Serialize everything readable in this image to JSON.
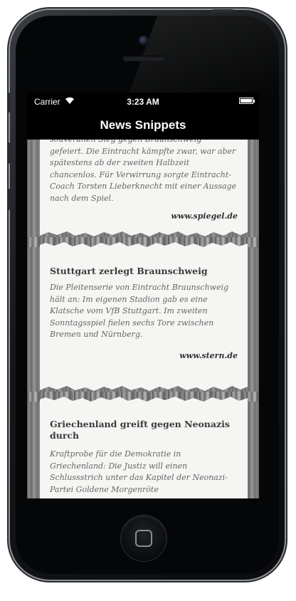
{
  "status_bar": {
    "carrier": "Carrier",
    "time": "3:23 AM"
  },
  "nav": {
    "title": "News Snippets"
  },
  "articles": [
    {
      "title": "",
      "body_line_0": "souveränen Sieg gegen Braunschweig",
      "body": "gefeiert. Die Eintracht kämpfte zwar, war aber spätestens ab der zweiten Halbzeit chancenlos. Für Verwirrung sorgte Eintracht-Coach Torsten Lieberknecht mit einer Aussage nach dem Spiel.",
      "source": "www.spiegel.de"
    },
    {
      "title": "Stuttgart zerlegt Braunschweig",
      "body": "Die Pleitenserie von Eintracht Braunschweig hält an: Im eigenen Stadion gab es eine Klatsche vom VfB Stuttgart. Im zweiten Sonntagsspiel fielen sechs Tore zwischen Bremen und Nürnberg.",
      "source": "www.stern.de"
    },
    {
      "title": "Griechenland greift gegen Neonazis durch",
      "body": "Kraftprobe für die Demokratie in Griechenland: Die Justiz will einen Schlussstrich unter das Kapitel der Neonazi-Partei Goldene Morgenröte",
      "source": ""
    }
  ]
}
